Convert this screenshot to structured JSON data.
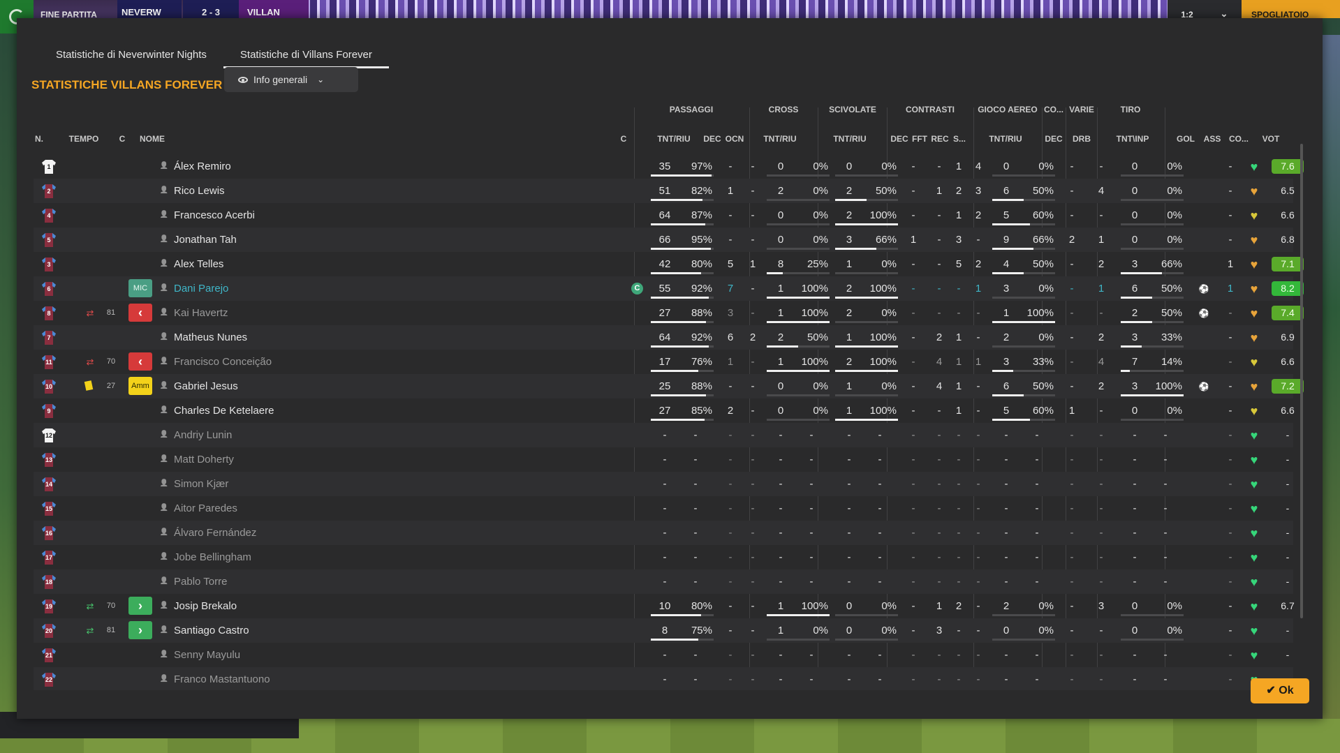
{
  "topbar": {
    "fine_partita": "FINE PARTITA",
    "home_team_short": "NEVERW",
    "score": "2 - 3",
    "away_team_short": "VILLAN",
    "clock": "1:2",
    "spogliatoio": "SPOGLIATOIO"
  },
  "tabs": [
    {
      "label": "Statistiche di Neverwinter Nights",
      "active": false
    },
    {
      "label": "Statistiche di Villans Forever",
      "active": true
    }
  ],
  "section_title": "STATISTICHE VILLANS FOREVER",
  "view_dropdown": {
    "label": "Info generali",
    "icon": "eye-icon"
  },
  "group_headers": [
    "PASSAGGI",
    "CROSS",
    "SCIVOLATE",
    "CONTRASTI",
    "GIOCO AEREO",
    "CO...",
    "VARIE",
    "TIRO"
  ],
  "column_headers": {
    "n": "N.",
    "tempo": "TEMPO",
    "c": "C",
    "nome": "NOME",
    "capt": "C",
    "pass_tnt_riu": "TNT/RIU",
    "pass_dec": "DEC",
    "pass_ocn": "OCN",
    "cross_tnt_riu": "TNT/RIU",
    "sciv_tnt_riu": "TNT/RIU",
    "con_dec": "DEC",
    "con_fft": "FFT",
    "con_rec": "REC",
    "con_s": "S...",
    "aereo_tnt_riu": "TNT/RIU",
    "co_dec": "DEC",
    "varie_drb": "DRB",
    "tiro_tnt_inp": "TNT\\INP",
    "gol": "GOL",
    "ass": "ASS",
    "co": "CO...",
    "vot": "VOT"
  },
  "players": [
    {
      "num": "1",
      "gk": true,
      "min": "",
      "sub": "",
      "card": "",
      "pos": "",
      "name": "Álex Remiro",
      "captain": false,
      "pt": "35",
      "pp": "97%",
      "pf": 0.97,
      "pd": "-",
      "po": "-",
      "ct": "0",
      "cp": "0%",
      "cf": 0,
      "st": "0",
      "sp": "0%",
      "sf": 0,
      "kd": "-",
      "kf": "-",
      "kr": "1",
      "ks": "4",
      "at": "0",
      "ap": "0%",
      "af": 0,
      "cod": "-",
      "drb": "-",
      "tt": "0",
      "tp": "0%",
      "tf": 0,
      "gol": "",
      "ass": "-",
      "co": "green",
      "vot": "7.6",
      "vcls": "good",
      "dim": false
    },
    {
      "num": "2",
      "gk": false,
      "min": "",
      "sub": "",
      "card": "",
      "pos": "",
      "name": "Rico Lewis",
      "captain": false,
      "pt": "51",
      "pp": "82%",
      "pf": 0.82,
      "pd": "1",
      "po": "-",
      "ct": "2",
      "cp": "0%",
      "cf": 0,
      "st": "2",
      "sp": "50%",
      "sf": 0.5,
      "kd": "-",
      "kf": "1",
      "kr": "2",
      "ks": "3",
      "at": "6",
      "ap": "50%",
      "af": 0.5,
      "cod": "-",
      "drb": "4",
      "tt": "0",
      "tp": "0%",
      "tf": 0,
      "gol": "",
      "ass": "-",
      "co": "orange",
      "vot": "6.5",
      "vcls": "",
      "dim": false
    },
    {
      "num": "4",
      "gk": false,
      "min": "",
      "sub": "",
      "card": "",
      "pos": "",
      "name": "Francesco Acerbi",
      "captain": false,
      "pt": "64",
      "pp": "87%",
      "pf": 0.87,
      "pd": "-",
      "po": "-",
      "ct": "0",
      "cp": "0%",
      "cf": 0,
      "st": "2",
      "sp": "100%",
      "sf": 1,
      "kd": "-",
      "kf": "-",
      "kr": "1",
      "ks": "2",
      "at": "5",
      "ap": "60%",
      "af": 0.6,
      "cod": "-",
      "drb": "-",
      "tt": "0",
      "tp": "0%",
      "tf": 0,
      "gol": "",
      "ass": "-",
      "co": "yellow",
      "vot": "6.6",
      "vcls": "",
      "dim": false
    },
    {
      "num": "5",
      "gk": false,
      "min": "",
      "sub": "",
      "card": "",
      "pos": "",
      "name": "Jonathan Tah",
      "captain": false,
      "pt": "66",
      "pp": "95%",
      "pf": 0.95,
      "pd": "-",
      "po": "-",
      "ct": "0",
      "cp": "0%",
      "cf": 0,
      "st": "3",
      "sp": "66%",
      "sf": 0.66,
      "kd": "1",
      "kf": "-",
      "kr": "3",
      "ks": "-",
      "at": "9",
      "ap": "66%",
      "af": 0.66,
      "cod": "2",
      "drb": "1",
      "tt": "0",
      "tp": "0%",
      "tf": 0,
      "gol": "",
      "ass": "-",
      "co": "orange",
      "vot": "6.8",
      "vcls": "",
      "dim": false
    },
    {
      "num": "3",
      "gk": false,
      "min": "",
      "sub": "",
      "card": "",
      "pos": "",
      "name": "Alex Telles",
      "captain": false,
      "pt": "42",
      "pp": "80%",
      "pf": 0.8,
      "pd": "5",
      "po": "1",
      "ct": "8",
      "cp": "25%",
      "cf": 0.25,
      "st": "1",
      "sp": "0%",
      "sf": 0,
      "kd": "-",
      "kf": "-",
      "kr": "5",
      "ks": "2",
      "at": "4",
      "ap": "50%",
      "af": 0.5,
      "cod": "-",
      "drb": "2",
      "tt": "3",
      "tp": "66%",
      "tf": 0.66,
      "gol": "",
      "ass": "1",
      "co": "orange",
      "vot": "7.1",
      "vcls": "good",
      "dim": false
    },
    {
      "num": "6",
      "gk": false,
      "min": "",
      "sub": "",
      "card": "",
      "pos": "MIC",
      "name": "Dani Parejo",
      "captain": true,
      "pt": "55",
      "pp": "92%",
      "pf": 0.92,
      "pd": "7",
      "po": "-",
      "ct": "1",
      "cp": "100%",
      "cf": 1,
      "st": "2",
      "sp": "100%",
      "sf": 1,
      "kd": "-",
      "kf": "-",
      "kr": "-",
      "ks": "1",
      "at": "3",
      "ap": "0%",
      "af": 0,
      "cod": "-",
      "drb": "1",
      "tt": "6",
      "tp": "50%",
      "tf": 0.5,
      "gol": "ball",
      "ass": "1",
      "co": "orange",
      "vot": "8.2",
      "vcls": "great",
      "dim": false
    },
    {
      "num": "8",
      "gk": false,
      "min": "81",
      "sub": "out",
      "card": "",
      "pos": "out",
      "name": "Kai Havertz",
      "captain": false,
      "pt": "27",
      "pp": "88%",
      "pf": 0.88,
      "pd": "3",
      "po": "-",
      "ct": "1",
      "cp": "100%",
      "cf": 1,
      "st": "2",
      "sp": "0%",
      "sf": 0,
      "kd": "-",
      "kf": "-",
      "kr": "-",
      "ks": "-",
      "at": "1",
      "ap": "100%",
      "af": 1,
      "cod": "-",
      "drb": "-",
      "tt": "2",
      "tp": "50%",
      "tf": 0.5,
      "gol": "ball",
      "ass": "-",
      "co": "orange",
      "vot": "7.4",
      "vcls": "good",
      "dim": true
    },
    {
      "num": "7",
      "gk": false,
      "min": "",
      "sub": "",
      "card": "",
      "pos": "",
      "name": "Matheus Nunes",
      "captain": false,
      "pt": "64",
      "pp": "92%",
      "pf": 0.92,
      "pd": "6",
      "po": "2",
      "ct": "2",
      "cp": "50%",
      "cf": 0.5,
      "st": "1",
      "sp": "100%",
      "sf": 1,
      "kd": "-",
      "kf": "2",
      "kr": "1",
      "ks": "-",
      "at": "2",
      "ap": "0%",
      "af": 0,
      "cod": "-",
      "drb": "2",
      "tt": "3",
      "tp": "33%",
      "tf": 0.33,
      "gol": "",
      "ass": "-",
      "co": "orange",
      "vot": "6.9",
      "vcls": "",
      "dim": false
    },
    {
      "num": "11",
      "gk": false,
      "min": "70",
      "sub": "out",
      "card": "",
      "pos": "out",
      "name": "Francisco Conceição",
      "captain": false,
      "pt": "17",
      "pp": "76%",
      "pf": 0.76,
      "pd": "1",
      "po": "-",
      "ct": "1",
      "cp": "100%",
      "cf": 1,
      "st": "2",
      "sp": "100%",
      "sf": 1,
      "kd": "-",
      "kf": "4",
      "kr": "1",
      "ks": "1",
      "at": "3",
      "ap": "33%",
      "af": 0.33,
      "cod": "-",
      "drb": "4",
      "tt": "7",
      "tp": "14%",
      "tf": 0.14,
      "gol": "",
      "ass": "-",
      "co": "yellow",
      "vot": "6.6",
      "vcls": "",
      "dim": true
    },
    {
      "num": "10",
      "gk": false,
      "min": "27",
      "sub": "",
      "card": "yellow",
      "pos": "Amm",
      "name": "Gabriel Jesus",
      "captain": false,
      "pt": "25",
      "pp": "88%",
      "pf": 0.88,
      "pd": "-",
      "po": "-",
      "ct": "0",
      "cp": "0%",
      "cf": 0,
      "st": "1",
      "sp": "0%",
      "sf": 0,
      "kd": "-",
      "kf": "4",
      "kr": "1",
      "ks": "-",
      "at": "6",
      "ap": "50%",
      "af": 0.5,
      "cod": "-",
      "drb": "2",
      "tt": "3",
      "tp": "100%",
      "tf": 1,
      "gol": "ball",
      "ass": "-",
      "co": "orange",
      "vot": "7.2",
      "vcls": "good",
      "dim": false
    },
    {
      "num": "9",
      "gk": false,
      "min": "",
      "sub": "",
      "card": "",
      "pos": "",
      "name": "Charles De Ketelaere",
      "captain": false,
      "pt": "27",
      "pp": "85%",
      "pf": 0.85,
      "pd": "2",
      "po": "-",
      "ct": "0",
      "cp": "0%",
      "cf": 0,
      "st": "1",
      "sp": "100%",
      "sf": 1,
      "kd": "-",
      "kf": "-",
      "kr": "1",
      "ks": "-",
      "at": "5",
      "ap": "60%",
      "af": 0.6,
      "cod": "1",
      "drb": "-",
      "tt": "0",
      "tp": "0%",
      "tf": 0,
      "gol": "",
      "ass": "-",
      "co": "yellow",
      "vot": "6.6",
      "vcls": "",
      "dim": false
    },
    {
      "num": "12",
      "gk": true,
      "min": "",
      "sub": "",
      "card": "",
      "pos": "",
      "name": "Andriy Lunin",
      "captain": false,
      "empty": true,
      "co": "green",
      "vot": "-",
      "dim": true
    },
    {
      "num": "13",
      "gk": false,
      "min": "",
      "sub": "",
      "card": "",
      "pos": "",
      "name": "Matt Doherty",
      "captain": false,
      "empty": true,
      "co": "green",
      "vot": "-",
      "dim": true
    },
    {
      "num": "14",
      "gk": false,
      "min": "",
      "sub": "",
      "card": "",
      "pos": "",
      "name": "Simon Kjær",
      "captain": false,
      "empty": true,
      "co": "green",
      "vot": "-",
      "dim": true
    },
    {
      "num": "15",
      "gk": false,
      "min": "",
      "sub": "",
      "card": "",
      "pos": "",
      "name": "Aitor Paredes",
      "captain": false,
      "empty": true,
      "co": "green",
      "vot": "-",
      "dim": true
    },
    {
      "num": "16",
      "gk": false,
      "min": "",
      "sub": "",
      "card": "",
      "pos": "",
      "name": "Álvaro Fernández",
      "captain": false,
      "empty": true,
      "co": "green",
      "vot": "-",
      "dim": true
    },
    {
      "num": "17",
      "gk": false,
      "min": "",
      "sub": "",
      "card": "",
      "pos": "",
      "name": "Jobe Bellingham",
      "captain": false,
      "empty": true,
      "co": "green",
      "vot": "-",
      "dim": true
    },
    {
      "num": "18",
      "gk": false,
      "min": "",
      "sub": "",
      "card": "",
      "pos": "",
      "name": "Pablo Torre",
      "captain": false,
      "empty": true,
      "co": "green",
      "vot": "-",
      "dim": true
    },
    {
      "num": "19",
      "gk": false,
      "min": "70",
      "sub": "in",
      "card": "",
      "pos": "in",
      "name": "Josip Brekalo",
      "captain": false,
      "pt": "10",
      "pp": "80%",
      "pf": 0.8,
      "pd": "-",
      "po": "-",
      "ct": "1",
      "cp": "100%",
      "cf": 1,
      "st": "0",
      "sp": "0%",
      "sf": 0,
      "kd": "-",
      "kf": "1",
      "kr": "2",
      "ks": "-",
      "at": "2",
      "ap": "0%",
      "af": 0,
      "cod": "-",
      "drb": "3",
      "tt": "0",
      "tp": "0%",
      "tf": 0,
      "gol": "",
      "ass": "-",
      "co": "green",
      "vot": "6.7",
      "vcls": "",
      "dim": false
    },
    {
      "num": "20",
      "gk": false,
      "min": "81",
      "sub": "in",
      "card": "",
      "pos": "in",
      "name": "Santiago Castro",
      "captain": false,
      "pt": "8",
      "pp": "75%",
      "pf": 0.75,
      "pd": "-",
      "po": "-",
      "ct": "1",
      "cp": "0%",
      "cf": 0,
      "st": "0",
      "sp": "0%",
      "sf": 0,
      "kd": "-",
      "kf": "3",
      "kr": "-",
      "ks": "-",
      "at": "0",
      "ap": "0%",
      "af": 0,
      "cod": "-",
      "drb": "-",
      "tt": "0",
      "tp": "0%",
      "tf": 0,
      "gol": "",
      "ass": "-",
      "co": "green",
      "vot": "-",
      "vcls": "",
      "dim": false
    },
    {
      "num": "21",
      "gk": false,
      "min": "",
      "sub": "",
      "card": "",
      "pos": "",
      "name": "Senny Mayulu",
      "captain": false,
      "empty": true,
      "co": "green",
      "vot": "-",
      "dim": true
    },
    {
      "num": "22",
      "gk": false,
      "min": "",
      "sub": "",
      "card": "",
      "pos": "",
      "name": "Franco Mastantuono",
      "captain": false,
      "empty": true,
      "co": "green",
      "vot": "-",
      "dim": true
    }
  ],
  "captain_badge": "C",
  "ok_button": "Ok",
  "colors": {
    "accent": "#f5a623",
    "heart_green": "#36d67a",
    "heart_orange": "#e8a43a",
    "heart_yellow": "#d8c83a",
    "rating_good": "#5aaa2a",
    "rating_great": "#33b83a"
  }
}
